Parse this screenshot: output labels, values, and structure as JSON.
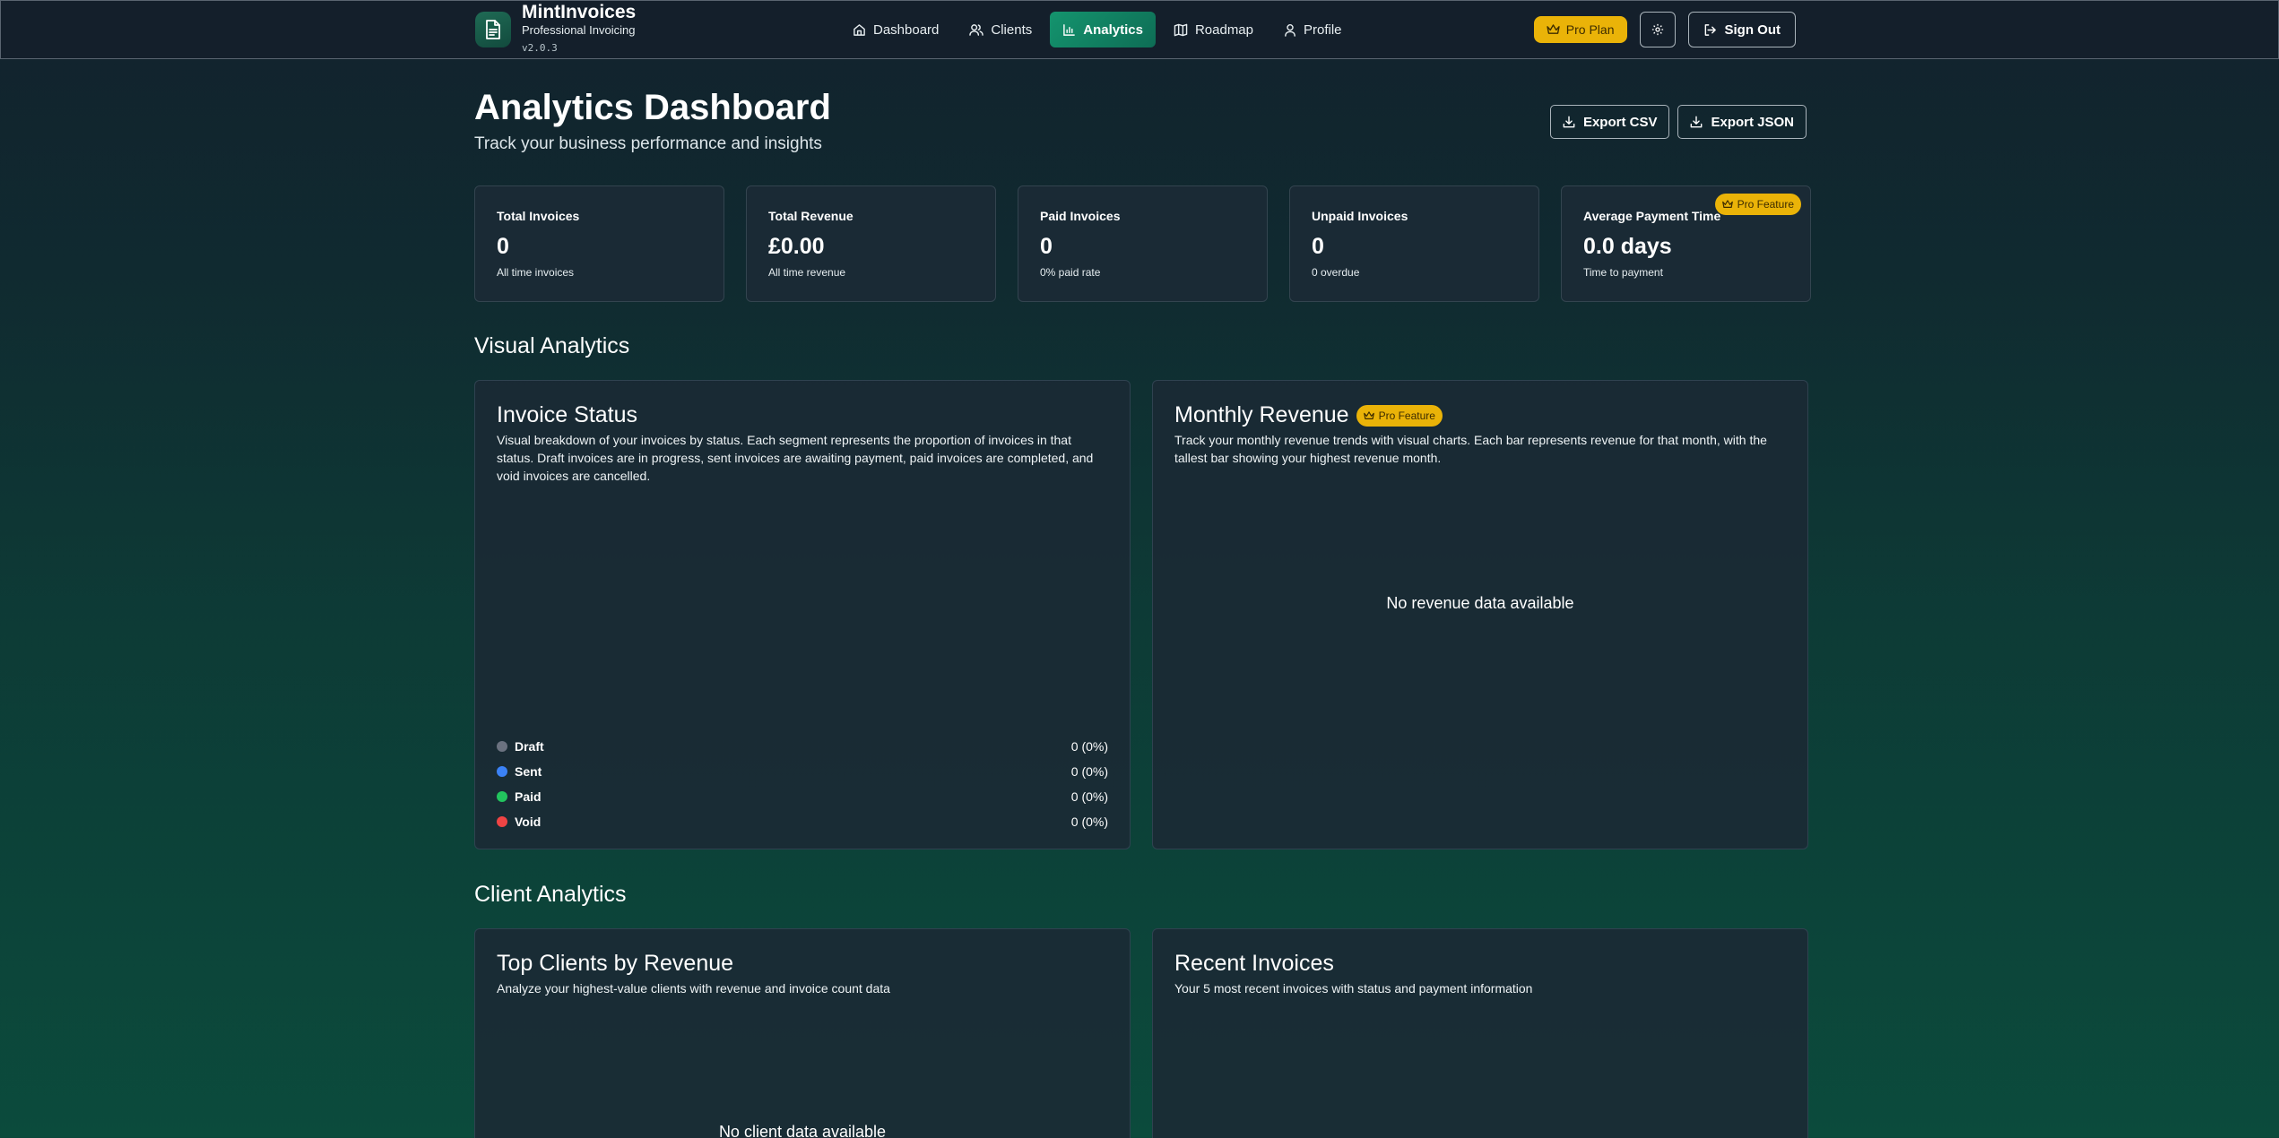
{
  "header": {
    "app_name": "MintInvoices",
    "app_tagline": "Professional Invoicing",
    "version": "v2.0.3",
    "nav": [
      {
        "label": "Dashboard",
        "icon": "home-icon"
      },
      {
        "label": "Clients",
        "icon": "users-icon"
      },
      {
        "label": "Analytics",
        "icon": "bar-chart-icon",
        "active": true
      },
      {
        "label": "Roadmap",
        "icon": "map-icon"
      },
      {
        "label": "Profile",
        "icon": "user-icon"
      }
    ],
    "plan_badge": "Pro Plan",
    "sign_out_label": "Sign Out"
  },
  "page": {
    "title": "Analytics Dashboard",
    "subtitle": "Track your business performance and insights",
    "export_csv_label": "Export CSV",
    "export_json_label": "Export JSON"
  },
  "stats": [
    {
      "label": "Total Invoices",
      "value": "0",
      "note": "All time invoices"
    },
    {
      "label": "Total Revenue",
      "value": "£0.00",
      "note": "All time revenue"
    },
    {
      "label": "Paid Invoices",
      "value": "0",
      "note": "0% paid rate"
    },
    {
      "label": "Unpaid Invoices",
      "value": "0",
      "note": "0 overdue"
    },
    {
      "label": "Average Payment Time",
      "value": "0.0 days",
      "note": "Time to payment",
      "badge": "Pro Feature"
    }
  ],
  "visual_analytics": {
    "section_title": "Visual Analytics",
    "invoice_status": {
      "title": "Invoice Status",
      "description": "Visual breakdown of your invoices by status. Each segment represents the proportion of invoices in that status. Draft invoices are in progress, sent invoices are awaiting payment, paid invoices are completed, and void invoices are cancelled.",
      "legend": [
        {
          "label": "Draft",
          "value": "0 (0%)",
          "color": "#6b7280"
        },
        {
          "label": "Sent",
          "value": "0 (0%)",
          "color": "#3b82f6"
        },
        {
          "label": "Paid",
          "value": "0 (0%)",
          "color": "#22c55e"
        },
        {
          "label": "Void",
          "value": "0 (0%)",
          "color": "#ef4444"
        }
      ]
    },
    "monthly_revenue": {
      "title": "Monthly Revenue",
      "badge": "Pro Feature",
      "description": "Track your monthly revenue trends with visual charts. Each bar represents revenue for that month, with the tallest bar showing your highest revenue month.",
      "empty_message": "No revenue data available"
    }
  },
  "client_analytics": {
    "section_title": "Client Analytics",
    "top_clients": {
      "title": "Top Clients by Revenue",
      "description": "Analyze your highest-value clients with revenue and invoice count data",
      "empty_message": "No client data available"
    },
    "recent_invoices": {
      "title": "Recent Invoices",
      "description": "Your 5 most recent invoices with status and payment information"
    }
  },
  "colors": {
    "accent": "#10b981",
    "pro_badge": "#eab308",
    "header_bg": "#141f2b"
  }
}
